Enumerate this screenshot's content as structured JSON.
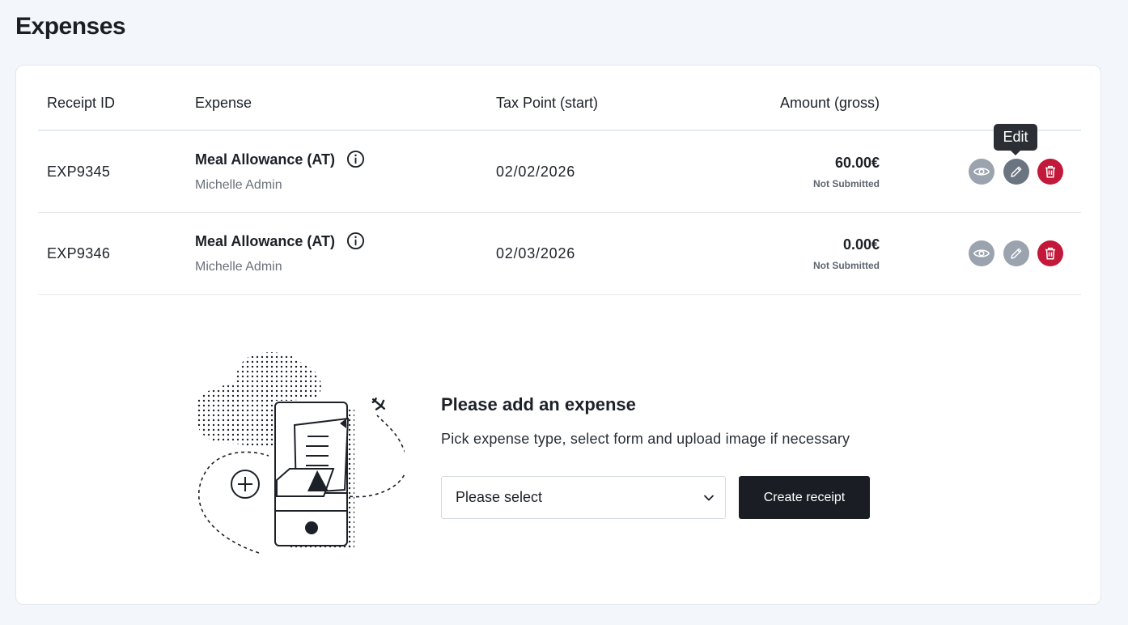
{
  "page": {
    "title": "Expenses"
  },
  "table": {
    "headers": {
      "receipt_id": "Receipt ID",
      "expense": "Expense",
      "tax_point": "Tax Point (start)",
      "amount": "Amount (gross)"
    },
    "rows": [
      {
        "receipt_id": "EXP9345",
        "expense_name": "Meal Allowance (AT)",
        "user": "Michelle Admin",
        "tax_point": "02/02/2026",
        "amount": "60.00€",
        "status": "Not Submitted"
      },
      {
        "receipt_id": "EXP9346",
        "expense_name": "Meal Allowance (AT)",
        "user": "Michelle Admin",
        "tax_point": "02/03/2026",
        "amount": "0.00€",
        "status": "Not Submitted"
      }
    ]
  },
  "tooltip": {
    "label": "Edit"
  },
  "empty_state": {
    "title": "Please add an expense",
    "description": "Pick expense type, select form and upload image if necessary",
    "select_value": "Please select",
    "create_button_label": "Create receipt"
  },
  "icons": {
    "info": "info-icon",
    "view": "eye-icon",
    "edit": "pencil-icon",
    "delete": "trash-icon",
    "select": "chevron-down-icon"
  },
  "colors": {
    "background": "#f3f6fa",
    "view_button": "#9aa3ae",
    "edit_button_active": "#6b7581",
    "delete_button": "#c2183a",
    "primary_button": "#1a1e24"
  }
}
